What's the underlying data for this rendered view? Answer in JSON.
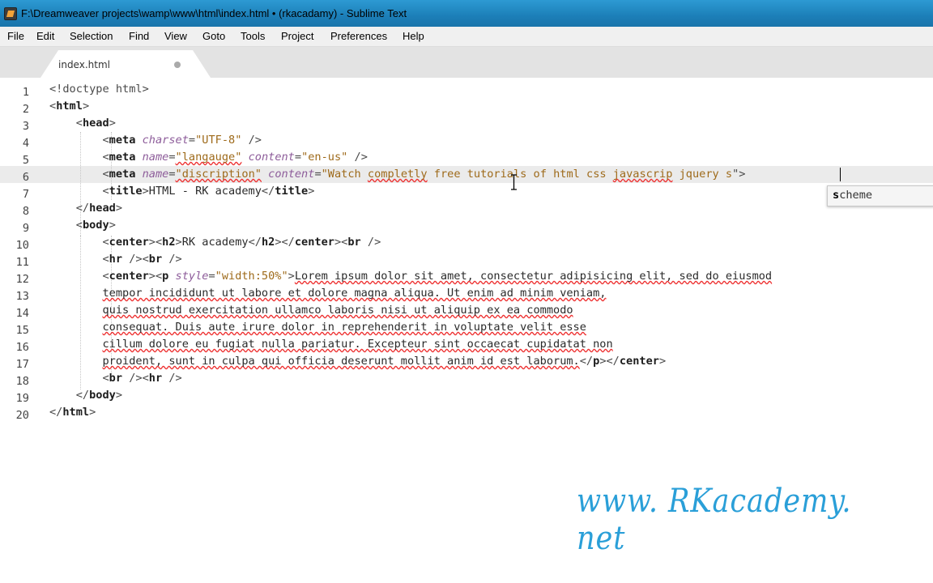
{
  "window": {
    "title": "F:\\Dreamweaver projects\\wamp\\www\\html\\index.html • (rkacadamy) - Sublime Text",
    "icon": "sublime-text-icon"
  },
  "menu": [
    "File",
    "Edit",
    "Selection",
    "Find",
    "View",
    "Goto",
    "Tools",
    "Project",
    "Preferences",
    "Help"
  ],
  "tab": {
    "label": "index.html",
    "dirty": true
  },
  "editor": {
    "current_line": 6,
    "line_numbers": [
      "1",
      "2",
      "3",
      "4",
      "5",
      "6",
      "7",
      "8",
      "9",
      "10",
      "11",
      "12",
      "13",
      "14",
      "15",
      "16",
      "17",
      "18",
      "19",
      "20"
    ]
  },
  "autocomplete": {
    "typed": "s",
    "rest": "cheme"
  },
  "watermark": "www. RKacademy. net"
}
